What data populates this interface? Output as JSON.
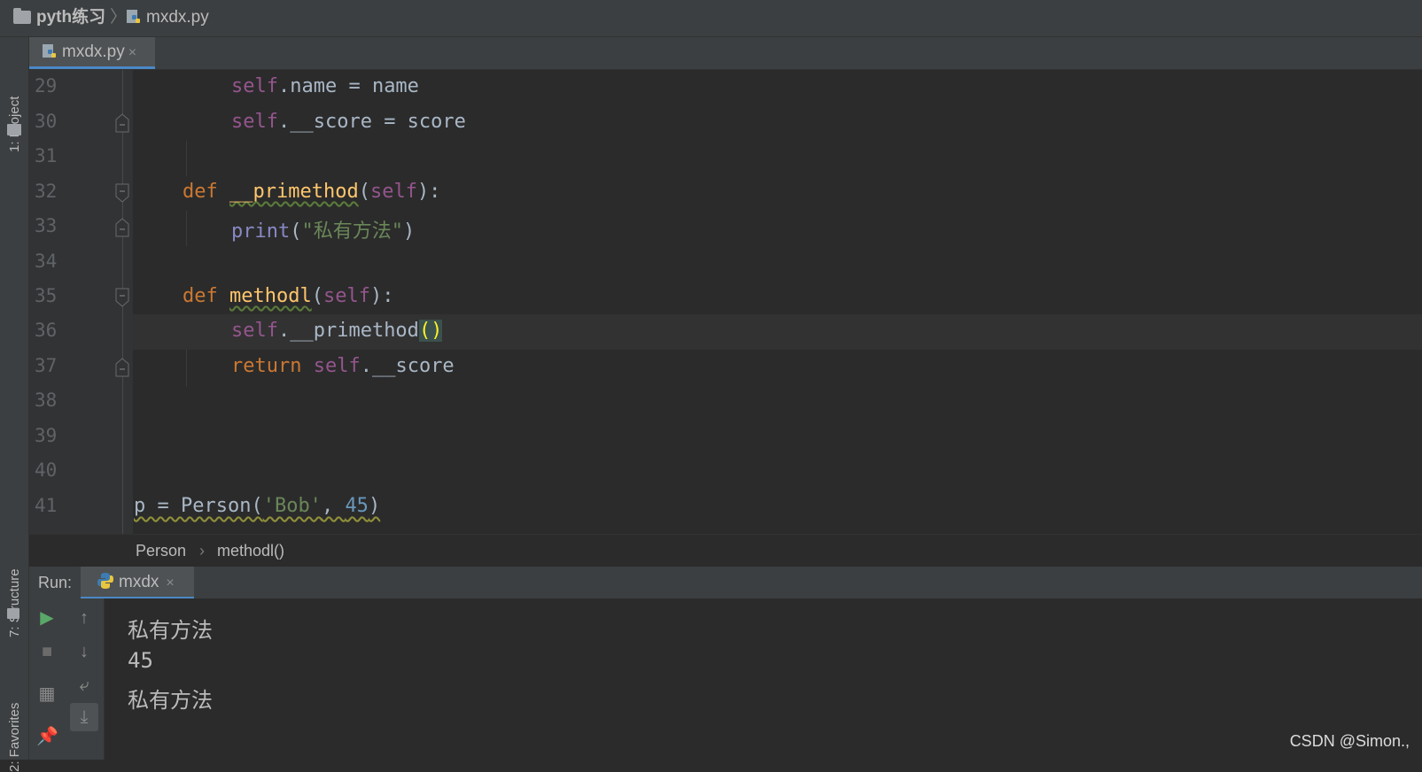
{
  "breadcrumb": {
    "project": "pyth练习",
    "separator": "〉",
    "file": "mxdx.py"
  },
  "left_strip": {
    "project_tab": "1: Project",
    "structure_tab": "7: Structure",
    "favorites_tab": "2: Favorites"
  },
  "editor_tab": {
    "label": "mxdx.py",
    "close": "×"
  },
  "code_lines": [
    {
      "num": "29"
    },
    {
      "num": "30"
    },
    {
      "num": "31"
    },
    {
      "num": "32"
    },
    {
      "num": "33"
    },
    {
      "num": "34"
    },
    {
      "num": "35"
    },
    {
      "num": "36"
    },
    {
      "num": "37"
    },
    {
      "num": "38"
    },
    {
      "num": "39"
    },
    {
      "num": "40"
    },
    {
      "num": "41"
    }
  ],
  "code": {
    "l29": {
      "self": "self",
      "rest": ".name = name"
    },
    "l30": {
      "self": "self",
      "rest": ".__score = score"
    },
    "l32": {
      "def": "def",
      "fn": "__primethod",
      "open": "(",
      "self": "self",
      "close": "):"
    },
    "l33": {
      "print": "print",
      "open": "(",
      "str": "\"私有方法\"",
      "close": ")"
    },
    "l35": {
      "def": "def",
      "fn": "methodl",
      "open": "(",
      "self": "self",
      "close": "):"
    },
    "l36": {
      "self": "self",
      "rest": ".__primethod",
      "parens": "()"
    },
    "l37": {
      "ret": "return",
      "self": "self",
      "rest": ".__score"
    },
    "l41": {
      "var": "p = Person(",
      "str": "'Bob'",
      "comma": ", ",
      "num": "45",
      "close": ")"
    }
  },
  "code_breadcrumb": {
    "class": "Person",
    "sep": "›",
    "method": "methodl()"
  },
  "run": {
    "label": "Run:",
    "tab": "mxdx",
    "close": "×"
  },
  "console_output": [
    "私有方法",
    "45",
    "私有方法"
  ],
  "watermark": "CSDN @Simon.,",
  "colors": {
    "keyword": "#cc7832",
    "self": "#94558d",
    "function": "#ffc66d",
    "string": "#6a8759",
    "number": "#6897bb",
    "accent": "#4a88c7"
  }
}
